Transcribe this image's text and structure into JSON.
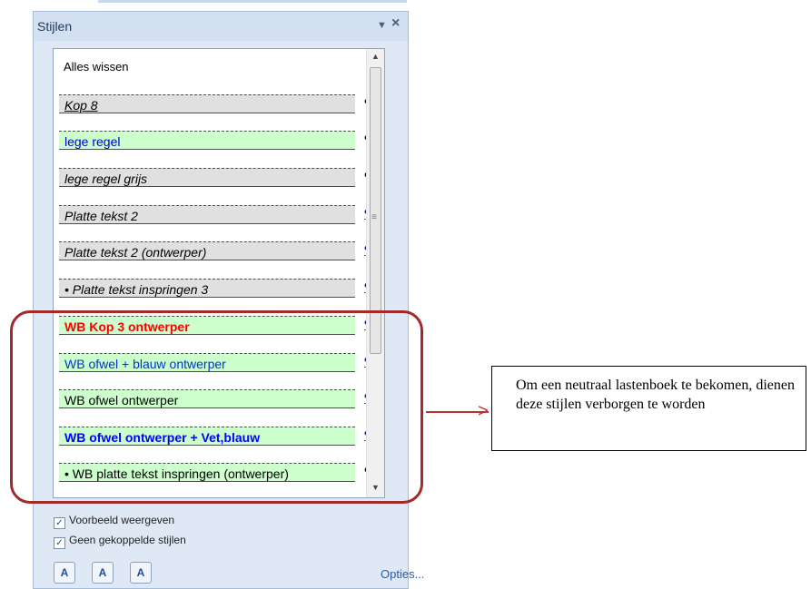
{
  "pane": {
    "title": "Stijlen",
    "dropdown_glyph": "▼",
    "close_glyph": "×",
    "clear_all": "Alles wissen"
  },
  "styles": [
    {
      "label": "Kop 8",
      "icon": "¶",
      "icon_kind": "paragraph",
      "bg": "#e0e0e0",
      "color": "#000000",
      "italic": true,
      "bold": false,
      "underline": true,
      "bullet": false
    },
    {
      "label": "lege regel",
      "icon": "¶",
      "icon_kind": "paragraph",
      "bg": "#ccffcc",
      "color": "#0000cc",
      "italic": false,
      "bold": false,
      "underline": false,
      "bullet": false
    },
    {
      "label": "lege regel grijs",
      "icon": "¶",
      "icon_kind": "paragraph",
      "bg": "#e0e0e0",
      "color": "#000000",
      "italic": true,
      "bold": false,
      "underline": false,
      "bullet": false
    },
    {
      "label": "Platte tekst 2",
      "icon": "¶a",
      "icon_kind": "linked",
      "bg": "#e0e0e0",
      "color": "#000000",
      "italic": true,
      "bold": false,
      "underline": false,
      "bullet": false
    },
    {
      "label": "Platte tekst 2 (ontwerper)",
      "icon": "¶a",
      "icon_kind": "linked",
      "bg": "#e0e0e0",
      "color": "#000000",
      "italic": true,
      "bold": false,
      "underline": false,
      "bullet": false
    },
    {
      "label": "Platte tekst inspringen 3",
      "icon": "¶a",
      "icon_kind": "linked",
      "bg": "#e0e0e0",
      "color": "#000000",
      "italic": true,
      "bold": false,
      "underline": false,
      "bullet": true
    },
    {
      "label": "WB Kop 3 ontwerper",
      "icon": "¶a",
      "icon_kind": "linked",
      "bg": "#ccffcc",
      "color": "#ff0000",
      "italic": false,
      "bold": true,
      "underline": false,
      "bullet": false
    },
    {
      "label": "WB ofwel + blauw ontwerper",
      "icon": "¶a",
      "icon_kind": "linked",
      "bg": "#ccffcc",
      "color": "#0033cc",
      "italic": false,
      "bold": false,
      "underline": false,
      "bullet": false
    },
    {
      "label": "WB ofwel ontwerper",
      "icon": "¶a",
      "icon_kind": "linked",
      "bg": "#ccffcc",
      "color": "#000000",
      "italic": false,
      "bold": false,
      "underline": false,
      "bullet": false
    },
    {
      "label": "WB ofwel ontwerper + Vet,blauw",
      "icon": "¶a",
      "icon_kind": "linked",
      "bg": "#ccffcc",
      "color": "#0000ff",
      "italic": false,
      "bold": true,
      "underline": false,
      "bullet": false
    },
    {
      "label": "WB platte tekst inspringen (ontwerper)",
      "icon": "¶",
      "icon_kind": "paragraph",
      "bg": "#ccffcc",
      "color": "#000000",
      "italic": false,
      "bold": false,
      "underline": false,
      "bullet": true
    }
  ],
  "checkboxes": [
    {
      "label": "Voorbeeld weergeven",
      "checked": true
    },
    {
      "label": "Geen gekoppelde stijlen",
      "checked": true
    }
  ],
  "toolbar": {
    "new_style_icon": "new-style-icon",
    "style_inspector_icon": "style-inspector-icon",
    "manage_styles_icon": "manage-styles-icon",
    "options_label": "Opties..."
  },
  "annotation": {
    "text": "Om een neutraal lastenboek te bekomen, dienen deze stijlen verborgen te worden",
    "highlight_color": "#a32a2a"
  }
}
